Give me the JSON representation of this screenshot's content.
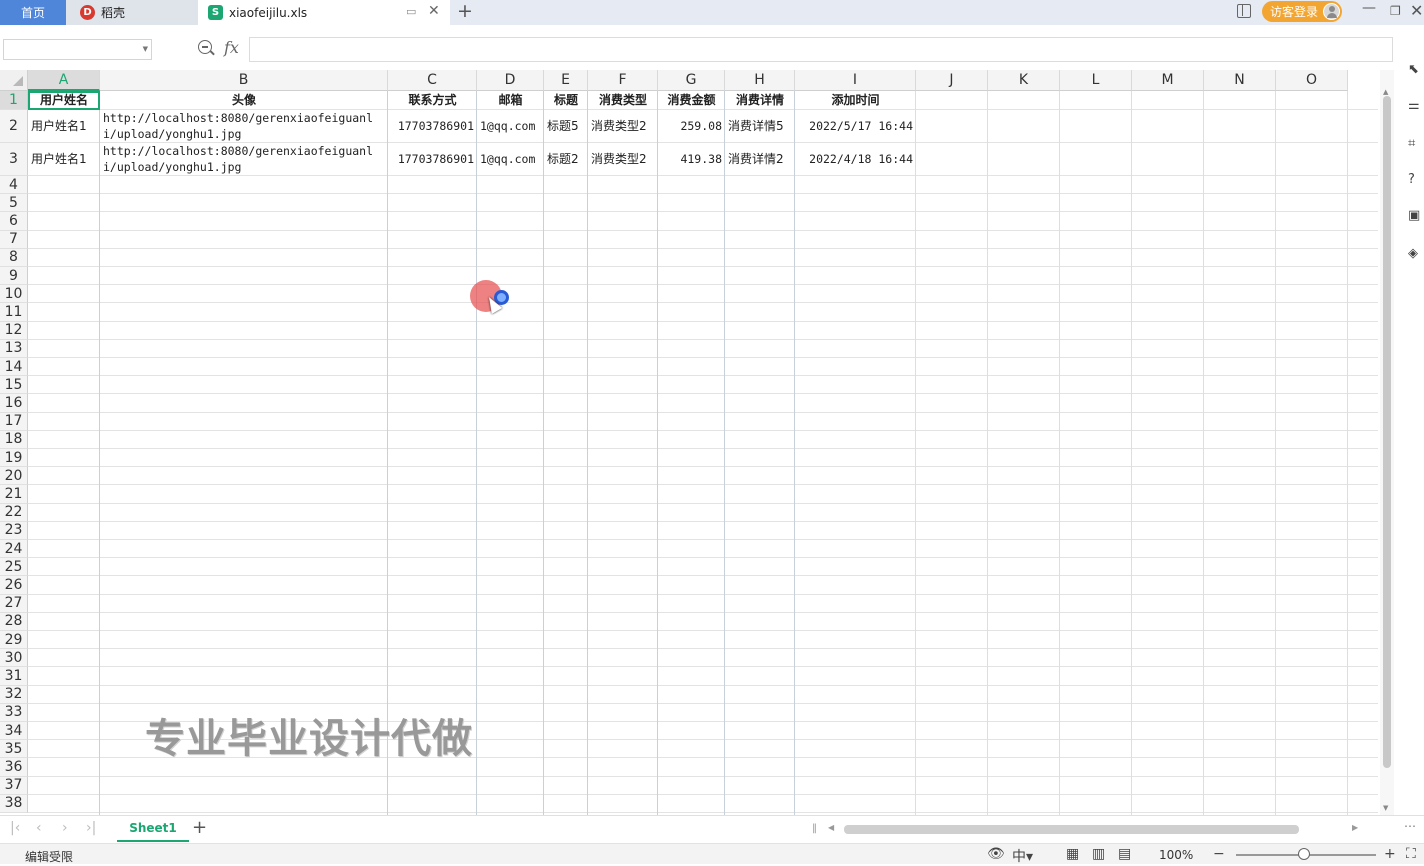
{
  "tabs": {
    "home": "首页",
    "daoke": "稻壳",
    "file": "xiaofeijilu.xls"
  },
  "titlebar": {
    "login": "访客登录"
  },
  "formula": {
    "name_box": "",
    "fx": "fx",
    "content": ""
  },
  "columns": [
    "A",
    "B",
    "C",
    "D",
    "E",
    "F",
    "G",
    "H",
    "I",
    "J",
    "K",
    "L",
    "M",
    "N",
    "O"
  ],
  "rows": [
    "1",
    "2",
    "3",
    "4",
    "5",
    "6",
    "7",
    "8",
    "9",
    "10",
    "11",
    "12",
    "13",
    "14",
    "15",
    "16",
    "17",
    "18",
    "19",
    "20",
    "21",
    "22",
    "23",
    "24",
    "25",
    "26",
    "27",
    "28",
    "29",
    "30",
    "31",
    "32",
    "33",
    "34",
    "35",
    "36",
    "37",
    "38"
  ],
  "table": {
    "headers": [
      "用户姓名",
      "头像",
      "联系方式",
      "邮箱",
      "标题",
      "消费类型",
      "消费金额",
      "消费详情",
      "添加时间"
    ],
    "records": [
      [
        "用户姓名1",
        "http://localhost:8080/gerenxiaofeiguanli/upload/yonghu1.jpg",
        "17703786901",
        "1@qq.com",
        "标题5",
        "消费类型2",
        "259.08",
        "消费详情5",
        "2022/5/17 16:44"
      ],
      [
        "用户姓名1",
        "http://localhost:8080/gerenxiaofeiguanli/upload/yonghu1.jpg",
        "17703786901",
        "1@qq.com",
        "标题2",
        "消费类型2",
        "419.38",
        "消费详情2",
        "2022/4/18 16:44"
      ]
    ]
  },
  "watermark": "专业毕业设计代做",
  "sheets": [
    "Sheet1"
  ],
  "status": {
    "text": "编辑受限",
    "zoom": "100%"
  },
  "accent_color": "#1ba672"
}
